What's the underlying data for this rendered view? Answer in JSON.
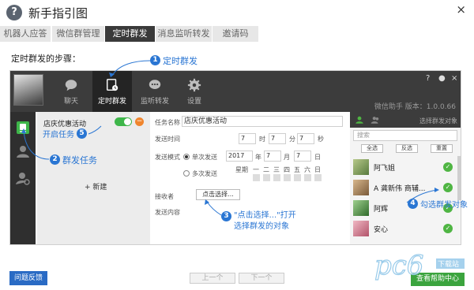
{
  "window": {
    "title": "新手指引图",
    "close_label": "×"
  },
  "tabs": [
    {
      "label": "机器人应答",
      "active": false
    },
    {
      "label": "微信群管理",
      "active": false
    },
    {
      "label": "定时群发",
      "active": true
    },
    {
      "label": "消息监听转发",
      "active": false
    },
    {
      "label": "邀请码",
      "active": false
    }
  ],
  "steps_title": "定时群发的步骤：",
  "app": {
    "nav": [
      {
        "label": "聊天",
        "icon": "chat-icon"
      },
      {
        "label": "定时群发",
        "icon": "timed-send-icon"
      },
      {
        "label": "监听转发",
        "icon": "listen-icon"
      },
      {
        "label": "设置",
        "icon": "settings-icon"
      }
    ],
    "controls": {
      "help": "?",
      "minimize": "●",
      "close": "×"
    },
    "version": "微信助手 版本：1.0.0.66",
    "task": {
      "name": "店庆优惠活动",
      "new_label": "+ 新建"
    },
    "form": {
      "task_name_label": "任务名称",
      "task_name_value": "店庆优惠活动",
      "send_time_label": "发送时间",
      "hour": "7",
      "hour_unit": "时",
      "minute": "7",
      "minute_unit": "分",
      "second": "7",
      "second_unit": "秒",
      "send_mode_label": "发送模式",
      "once_label": "单次发送",
      "year": "2017",
      "year_unit": "年",
      "month": "7",
      "month_unit": "月",
      "day": "7",
      "day_unit": "日",
      "multi_label": "多次发送",
      "weekday_label": "星期",
      "weekdays": [
        "一",
        "二",
        "三",
        "四",
        "五",
        "六",
        "日"
      ],
      "receiver_label": "接收者",
      "choose_button": "点击选择...",
      "content_label": "发送内容"
    },
    "right": {
      "header": "选择群发对象",
      "search_placeholder": "搜索",
      "buttons": [
        "全选",
        "反选",
        "重置"
      ],
      "contacts": [
        {
          "name": "阿飞姐"
        },
        {
          "name": "A 龚新伟 商辅..."
        },
        {
          "name": "阿辉"
        },
        {
          "name": "安心"
        }
      ]
    }
  },
  "annotations": [
    {
      "num": "1",
      "text": "定时群发"
    },
    {
      "num": "2",
      "text": "群发任务"
    },
    {
      "num": "3",
      "text": "\"点击选择...\"打开\n选择群发的对象"
    },
    {
      "num": "4",
      "text": "勾选群发对象"
    },
    {
      "num": "5",
      "text": "开启任务"
    }
  ],
  "bottom": {
    "feedback": "问题反馈",
    "prev": "上一个",
    "next": "下一个",
    "help": "查看帮助中心"
  },
  "watermark": "pc6 下载站",
  "colors": {
    "accent": "#2a76d3",
    "dark": "#3c3c3c",
    "green": "#3ba43e"
  }
}
